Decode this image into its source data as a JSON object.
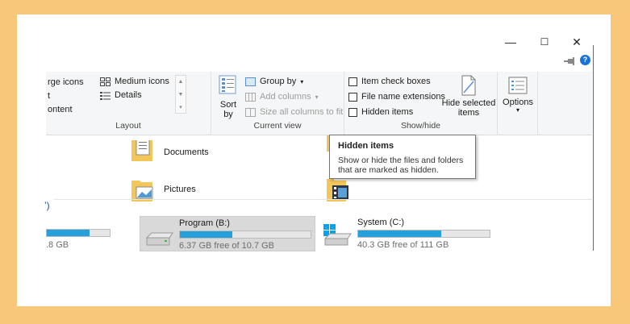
{
  "window": {
    "minimize": "—",
    "maximize": "☐",
    "close": "✕",
    "help": "?"
  },
  "ribbon": {
    "layout": {
      "items": [
        "rge icons",
        "Medium icons",
        "t",
        "Details",
        "ontent"
      ],
      "label": "Layout"
    },
    "current_view": {
      "sort_by": "Sort\nby",
      "group_by": "Group by",
      "add_columns": "Add columns",
      "size_all_columns": "Size all columns to fit",
      "label": "Current view"
    },
    "show_hide": {
      "item_check_boxes": "Item check boxes",
      "file_name_extensions": "File name extensions",
      "hidden_items": "Hidden items",
      "hide_selected_items": "Hide selected\nitems",
      "label": "Show/hide"
    },
    "options": {
      "label": "Options"
    }
  },
  "folders": [
    {
      "name": "Documents"
    },
    {
      "name": "Pictures"
    }
  ],
  "group_label": "’)",
  "drives": [
    {
      "name": "",
      "free": ".8 GB",
      "used_fraction": 0.68
    },
    {
      "name": "Program (B:)",
      "free": "6.37 GB free of 10.7 GB",
      "used_fraction": 0.4
    },
    {
      "name": "System (C:)",
      "free": "40.3 GB free of 111 GB",
      "used_fraction": 0.63
    }
  ],
  "tooltip": {
    "title": "Hidden items",
    "body": "Show or hide the files and folders that are marked as hidden."
  },
  "colors": {
    "accent": "#26a0da",
    "frame_bg": "#f8c77a",
    "help_blue": "#1c73d6"
  }
}
